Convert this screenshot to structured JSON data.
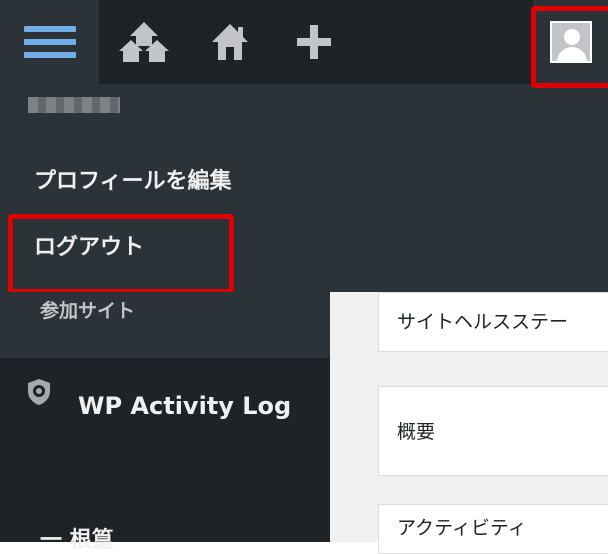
{
  "admin_bar": {
    "menu_icon": "hamburger-menu-icon",
    "my_sites_icon": "my-sites-icon",
    "home_icon": "home-icon",
    "new_icon": "plus-icon",
    "avatar_icon": "user-avatar-icon"
  },
  "account_menu": {
    "username": "",
    "edit_profile": "プロフィールを編集",
    "logout": "ログアウト"
  },
  "sidebar": {
    "sites_label": "参加サイト",
    "plugin_label": "WP Activity Log",
    "plugin_icon": "shield-icon",
    "next_item": "一 根篁"
  },
  "main": {
    "cards": [
      "サイトヘルスステー",
      "概要",
      "アクティビティ"
    ]
  },
  "colors": {
    "admin_bar_bg": "#1d2327",
    "submenu_bg": "#2c3338",
    "accent_blue": "#72aee6",
    "highlight_red": "#e00000",
    "content_bg": "#f0f0f1"
  }
}
